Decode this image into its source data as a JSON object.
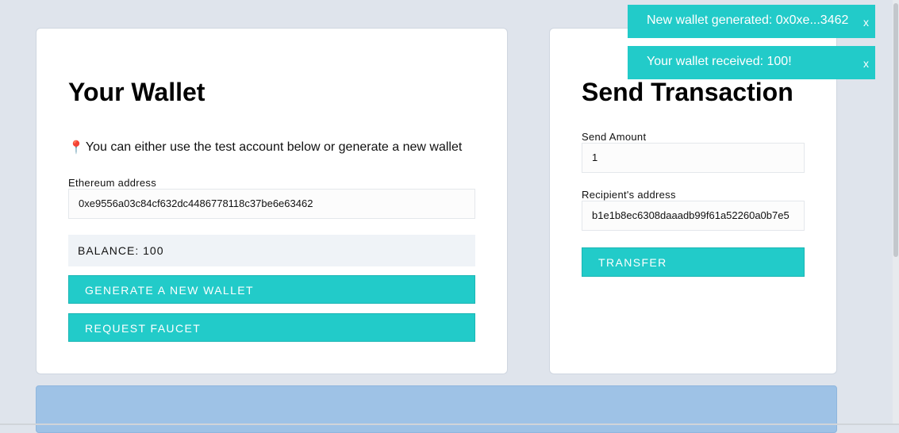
{
  "wallet": {
    "title": "Your Wallet",
    "info_text": "You can either use the test account below or generate a new wallet",
    "address_label": "Ethereum address",
    "address_value": "0xe9556a03c84cf632dc4486778118c37be6e63462",
    "balance_text": "BALANCE: 100",
    "generate_button": "GENERATE A NEW WALLET",
    "faucet_button": "REQUEST FAUCET"
  },
  "send": {
    "title": "Send Transaction",
    "amount_label": "Send Amount",
    "amount_value": "1",
    "recipient_label": "Recipient's address",
    "recipient_value": "b1e1b8ec6308daaadb99f61a52260a0b7e5",
    "transfer_button": "TRANSFER"
  },
  "toasts": [
    {
      "message": "New wallet generated: 0x0xe...3462",
      "close": "x"
    },
    {
      "message": "Your wallet received: 100!",
      "close": "x"
    }
  ],
  "colors": {
    "accent": "#22cbc9",
    "background": "#dfe4ec",
    "bottom_panel": "#9ec2e6"
  },
  "icons": {
    "info": "pin-icon"
  }
}
